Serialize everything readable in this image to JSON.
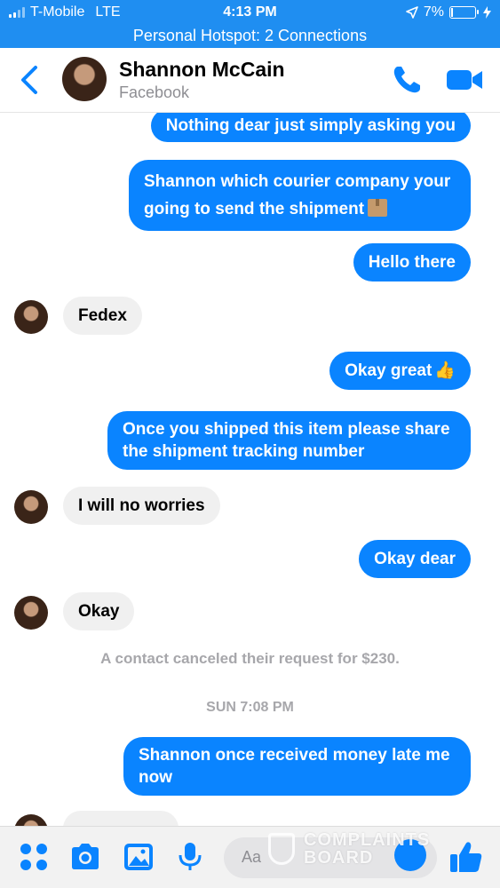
{
  "status_bar": {
    "carrier": "T-Mobile",
    "network": "LTE",
    "time": "4:13 PM",
    "battery": "7%",
    "battery_level": 0.07
  },
  "hotspot_banner": "Personal Hotspot: 2 Connections",
  "header": {
    "contact_name": "Shannon McCain",
    "contact_source": "Facebook"
  },
  "messages": [
    {
      "direction": "out",
      "text": "Nothing dear just simply asking you"
    },
    {
      "direction": "out",
      "text": "Shannon which courier company your going to send the shipment"
    },
    {
      "direction": "out",
      "text": "Hello there"
    },
    {
      "direction": "in",
      "text": "Fedex"
    },
    {
      "direction": "out",
      "text": "Okay great"
    },
    {
      "direction": "out",
      "text": "Once you shipped this item please share the shipment tracking number"
    },
    {
      "direction": "in",
      "text": "I will no worries"
    },
    {
      "direction": "out",
      "text": "Okay dear"
    },
    {
      "direction": "in",
      "text": "Okay"
    }
  ],
  "system_note": "A contact canceled their request for $230.",
  "timestamp": "SUN 7:08 PM",
  "messages_after": [
    {
      "direction": "out",
      "text": "Shannon once received money late me now"
    }
  ],
  "composer": {
    "placeholder": "Aa"
  },
  "watermark": {
    "line1": "COMPLAINTS",
    "line2": "BOARD"
  },
  "colors": {
    "ios_blue": "#1f8ef1",
    "bubble_out": "#0a84ff",
    "bubble_in": "#f0f0f0",
    "muted_text": "#a7a7ab"
  },
  "icons": [
    "signal-icon",
    "location-arrow-icon",
    "battery-icon",
    "charging-icon",
    "back-chevron-icon",
    "phone-icon",
    "video-camera-icon",
    "package-emoji-icon",
    "thumbs-up-emoji-icon",
    "apps-grid-icon",
    "camera-icon",
    "gallery-icon",
    "microphone-icon",
    "emoji-icon",
    "like-thumb-icon"
  ]
}
